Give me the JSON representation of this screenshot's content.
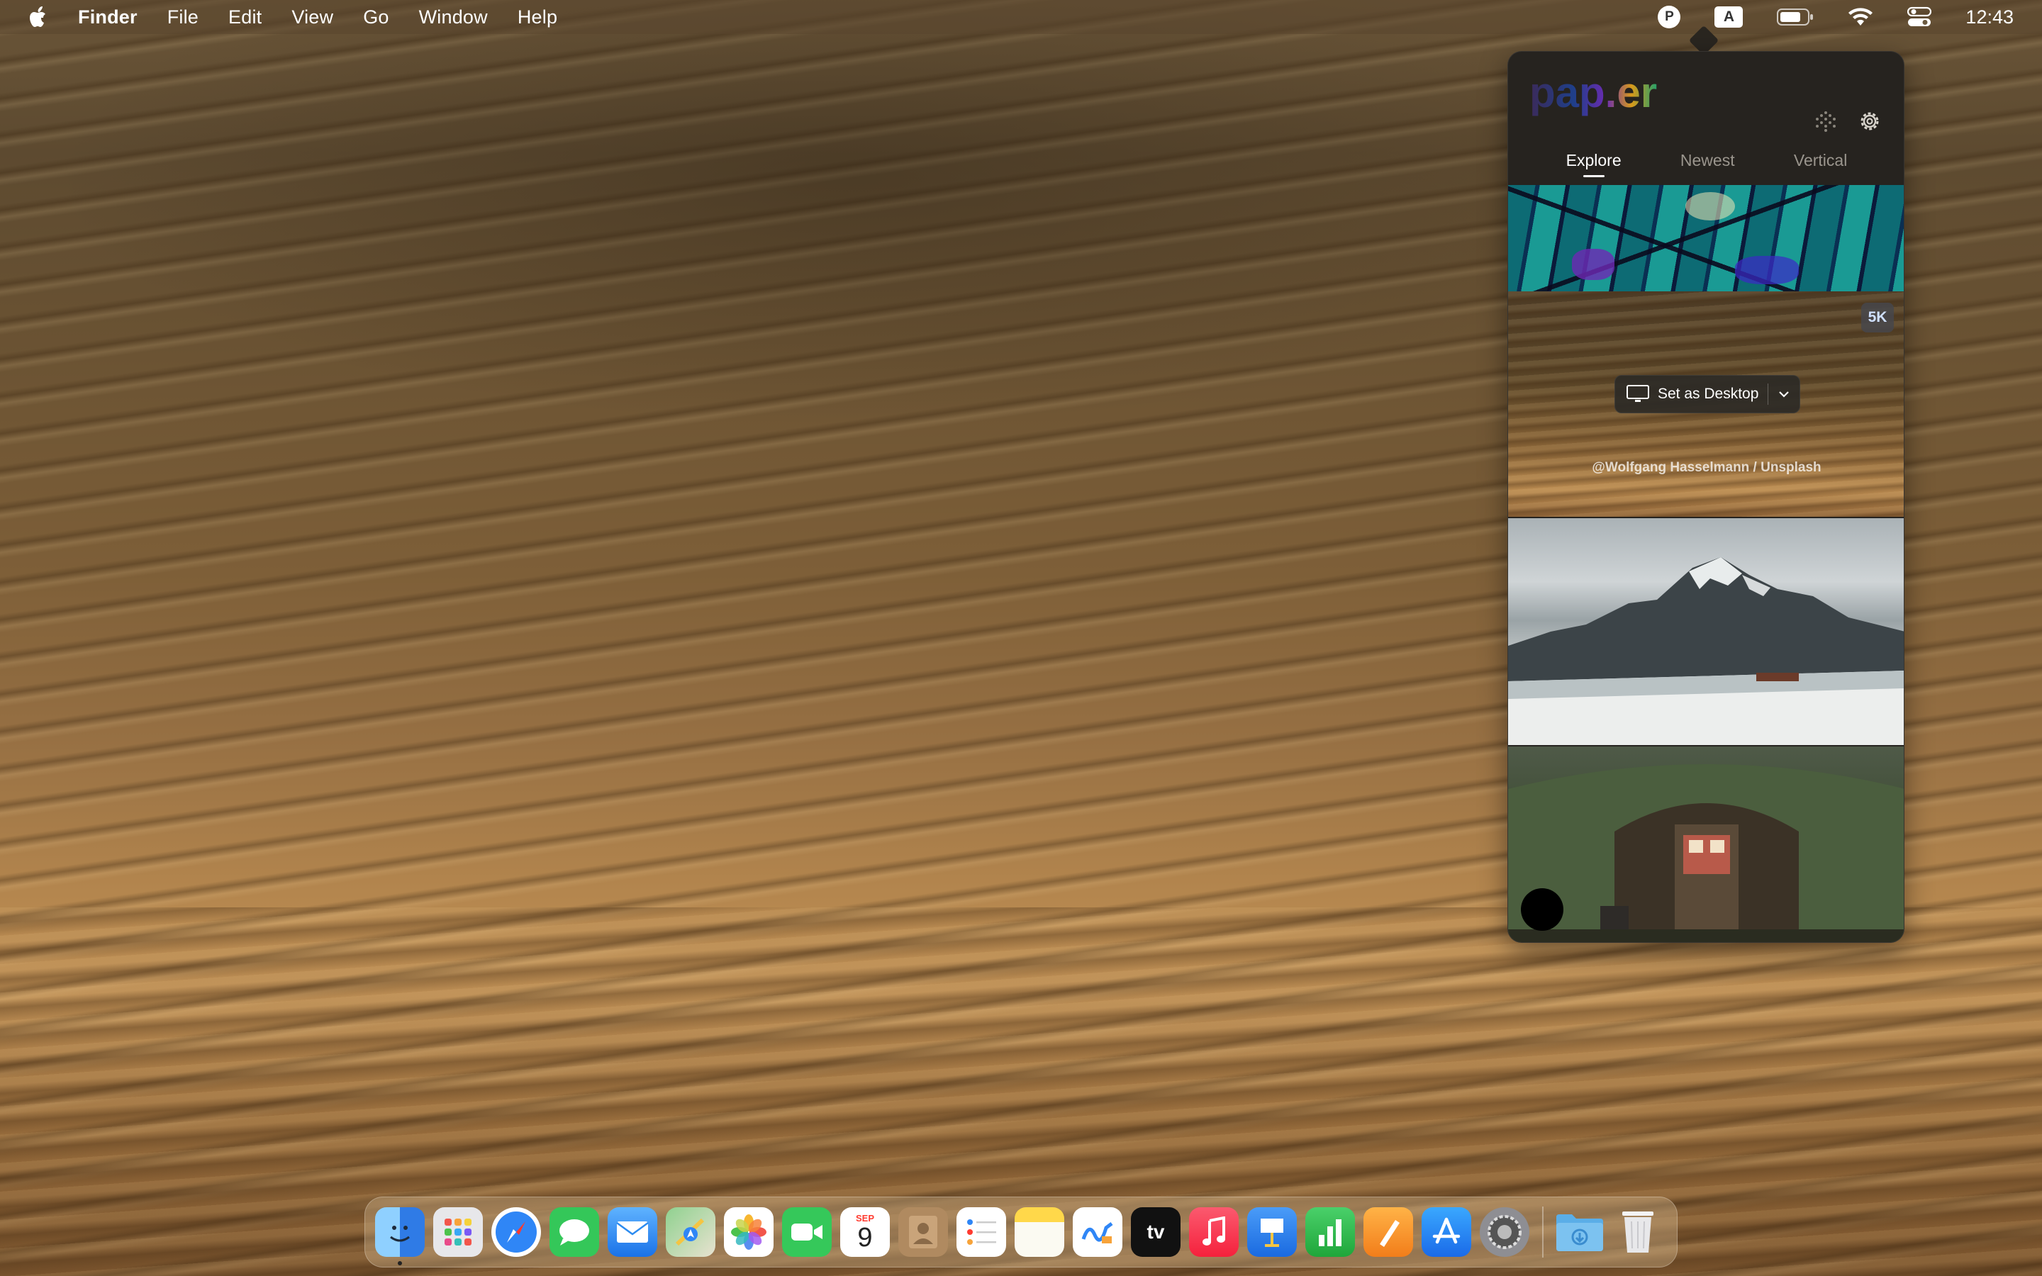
{
  "menubar": {
    "app_name": "Finder",
    "menus": [
      "File",
      "Edit",
      "View",
      "Go",
      "Window",
      "Help"
    ],
    "status_icons": [
      "papr-menu-icon",
      "input-source-icon",
      "battery-icon",
      "wifi-icon",
      "control-center-icon"
    ],
    "input_source_label": "A",
    "papr_label": "P",
    "clock": "12:43"
  },
  "popover": {
    "logo_text": "pap.er",
    "tabs": [
      {
        "label": "Explore",
        "active": true
      },
      {
        "label": "Newest",
        "active": false
      },
      {
        "label": "Vertical",
        "active": false
      }
    ],
    "featured": {
      "resolution_badge": "5K",
      "set_desktop_label": "Set as Desktop",
      "credit": "@Wolfgang Hasselmann / Unsplash"
    }
  },
  "dock": {
    "apps": [
      {
        "name": "Finder",
        "icon": "finder-icon",
        "color": "#3a8ef0",
        "running": true
      },
      {
        "name": "Launchpad",
        "icon": "launchpad-icon",
        "color": "#e7e7ea"
      },
      {
        "name": "Safari",
        "icon": "safari-icon",
        "color": "#2f86f6"
      },
      {
        "name": "Messages",
        "icon": "messages-icon",
        "color": "#34c759"
      },
      {
        "name": "Mail",
        "icon": "mail-icon",
        "color": "#2d8cf0"
      },
      {
        "name": "Maps",
        "icon": "maps-icon",
        "color": "#6cc26c"
      },
      {
        "name": "Photos",
        "icon": "photos-icon",
        "color": "#ffffff"
      },
      {
        "name": "FaceTime",
        "icon": "facetime-icon",
        "color": "#35c85a"
      },
      {
        "name": "Calendar",
        "icon": "calendar-icon",
        "color": "#ffffff",
        "month": "SEP",
        "day": "9"
      },
      {
        "name": "Contacts",
        "icon": "contacts-icon",
        "color": "#b08a60"
      },
      {
        "name": "Reminders",
        "icon": "reminders-icon",
        "color": "#ffffff"
      },
      {
        "name": "Notes",
        "icon": "notes-icon",
        "color": "#ffd84a"
      },
      {
        "name": "Freeform",
        "icon": "freeform-icon",
        "color": "#ffffff"
      },
      {
        "name": "TV",
        "icon": "tv-icon",
        "color": "#111111",
        "label": "tv"
      },
      {
        "name": "Music",
        "icon": "music-icon",
        "color": "#fa2d48"
      },
      {
        "name": "Keynote",
        "icon": "keynote-icon",
        "color": "#2e7cf6"
      },
      {
        "name": "Numbers",
        "icon": "numbers-icon",
        "color": "#30c24a"
      },
      {
        "name": "Pages",
        "icon": "pages-icon",
        "color": "#f79a2a"
      },
      {
        "name": "App Store",
        "icon": "app-store-icon",
        "color": "#1e8ef7"
      },
      {
        "name": "System Settings",
        "icon": "system-settings-icon",
        "color": "#8e8e93"
      }
    ],
    "extras": [
      {
        "name": "Downloads",
        "icon": "downloads-folder-icon",
        "color": "#5aaee8"
      },
      {
        "name": "Trash",
        "icon": "trash-icon",
        "color": "#e8e8ea"
      }
    ]
  }
}
